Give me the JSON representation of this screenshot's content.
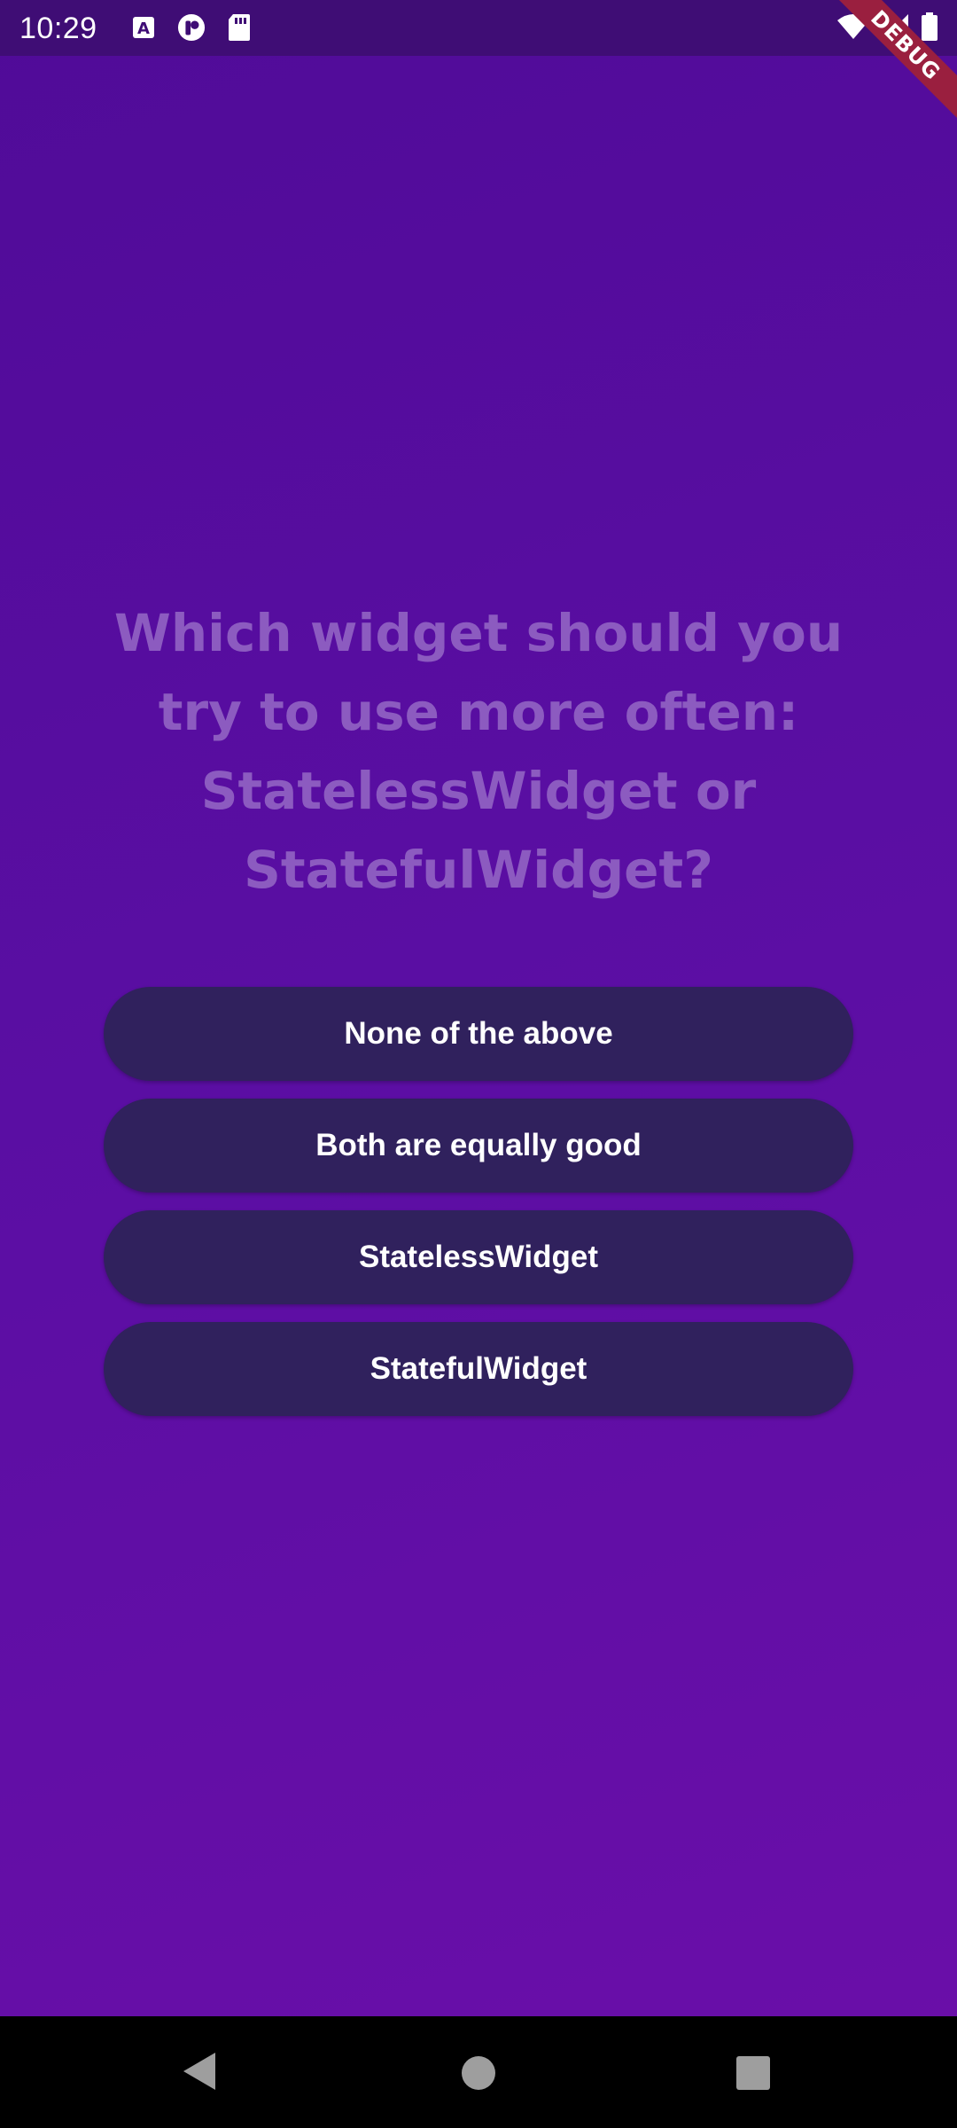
{
  "status_bar": {
    "time": "10:29",
    "left_icons": [
      "font-icon",
      "app-icon",
      "sd-card-icon"
    ],
    "right_icons": [
      "wifi-icon",
      "signal-icon",
      "battery-icon"
    ]
  },
  "debug_banner": {
    "label": "DEBUG",
    "color": "#9a1f3f"
  },
  "quiz": {
    "question": "Which widget should you try to use more often: StatelessWidget or StatefulWidget?",
    "answers": [
      "None of the above",
      "Both are equally good",
      "StatelessWidget",
      "StatefulWidget"
    ]
  },
  "colors": {
    "background_top": "#500b98",
    "background_bottom": "#6b0ea9",
    "question_text": "#8c5bc0",
    "button_bg": "#30215d",
    "button_text": "#ffffff"
  },
  "nav_bar": {
    "buttons": [
      "back-icon",
      "home-icon",
      "recents-icon"
    ]
  }
}
